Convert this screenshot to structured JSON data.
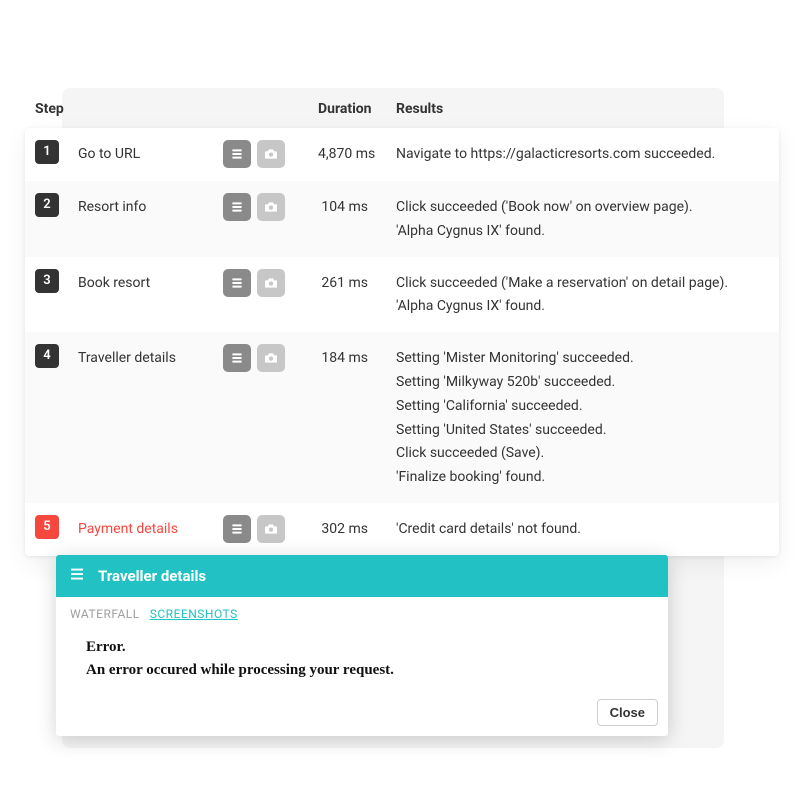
{
  "headers": {
    "step": "Step",
    "duration": "Duration",
    "results": "Results"
  },
  "steps": [
    {
      "num": "1",
      "name": "Go to URL",
      "duration": "4,870 ms",
      "error": false,
      "results": [
        "Navigate to https://galacticresorts.com succeeded."
      ]
    },
    {
      "num": "2",
      "name": "Resort info",
      "duration": "104 ms",
      "error": false,
      "results": [
        "Click succeeded ('Book now' on overview page).",
        "'Alpha Cygnus IX' found."
      ]
    },
    {
      "num": "3",
      "name": "Book resort",
      "duration": "261 ms",
      "error": false,
      "results": [
        "Click succeeded ('Make a reservation' on detail page).",
        "'Alpha Cygnus IX' found."
      ]
    },
    {
      "num": "4",
      "name": "Traveller details",
      "duration": "184 ms",
      "error": false,
      "results": [
        "Setting 'Mister Monitoring' succeeded.",
        "Setting 'Milkyway 520b' succeeded.",
        "Setting 'California' succeeded.",
        "Setting 'United States' succeeded.",
        "Click succeeded (Save).",
        "'Finalize booking' found."
      ]
    },
    {
      "num": "5",
      "name": "Payment details",
      "duration": "302 ms",
      "error": true,
      "results": [
        "'Credit card details' not found."
      ]
    }
  ],
  "popup": {
    "title": "Traveller details",
    "tab_waterfall": "WATERFALL",
    "tab_screenshots": "SCREENSHOTS",
    "error_title": "Error.",
    "error_message": "An error occured while processing your request.",
    "close": "Close"
  }
}
